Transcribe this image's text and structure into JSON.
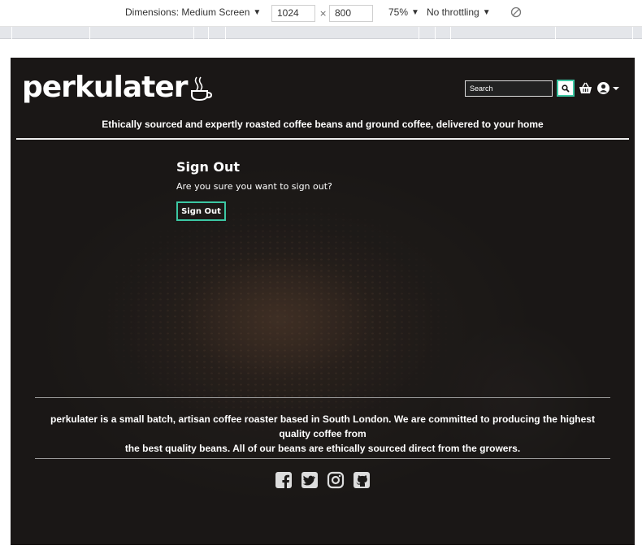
{
  "devtools": {
    "dimensions_label": "Dimensions: Medium Screen",
    "width": "1024",
    "times": "×",
    "height": "800",
    "zoom": "75%",
    "throttling": "No throttling",
    "caret": "▼"
  },
  "site": {
    "brand": "perkulater",
    "search": {
      "placeholder": "Search"
    },
    "tagline": "Ethically sourced and expertly roasted coffee beans and ground coffee, delivered to your home",
    "signout": {
      "title": "Sign Out",
      "prompt": "Are you sure you want to sign out?",
      "button": "Sign Out"
    },
    "footer": {
      "line1": "perkulater is a small batch, artisan coffee roaster based in South London. We are committed to producing the highest quality coffee from",
      "line2": "the best quality beans. All of our beans are ethically sourced direct from the growers."
    },
    "social_icons": [
      "facebook-icon",
      "twitter-icon",
      "instagram-icon",
      "github-icon"
    ],
    "colors": {
      "accent": "#3cc7a3",
      "background": "#1c1a19",
      "text": "#ffffff"
    }
  }
}
